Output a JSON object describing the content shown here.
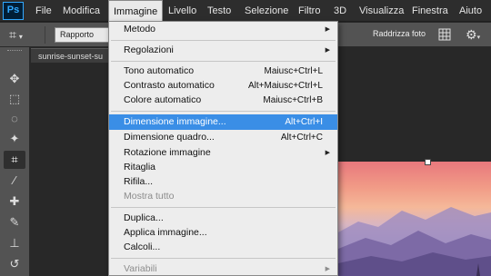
{
  "app": {
    "logo": "Ps"
  },
  "menubar": {
    "items": [
      {
        "label": "File"
      },
      {
        "label": "Modifica"
      },
      {
        "label": "Immagine"
      },
      {
        "label": "Livello"
      },
      {
        "label": "Testo"
      },
      {
        "label": "Selezione"
      },
      {
        "label": "Filtro"
      },
      {
        "label": "3D"
      },
      {
        "label": "Visualizza"
      },
      {
        "label": "Finestra"
      },
      {
        "label": "Aiuto"
      }
    ],
    "active": "Immagine"
  },
  "options": {
    "tool_icon": "crop-icon",
    "ratio_value": "Rapporto",
    "straighten_label": "Raddrizza foto",
    "grid_icon": "grid-overlay-icon",
    "settings_icon": "gear-icon"
  },
  "toolbar": {
    "tools": [
      {
        "name": "move-tool-icon",
        "glyph": "✥"
      },
      {
        "name": "marquee-tool-icon",
        "glyph": "⬚"
      },
      {
        "name": "lasso-tool-icon",
        "glyph": "◌"
      },
      {
        "name": "magic-wand-tool-icon",
        "glyph": "✦"
      },
      {
        "name": "crop-tool-icon",
        "glyph": "⌗"
      },
      {
        "name": "eyedropper-tool-icon",
        "glyph": "⁄"
      },
      {
        "name": "healing-brush-tool-icon",
        "glyph": "✚"
      },
      {
        "name": "brush-tool-icon",
        "glyph": "✎"
      },
      {
        "name": "stamp-tool-icon",
        "glyph": "⊥"
      },
      {
        "name": "history-brush-tool-icon",
        "glyph": "↺"
      }
    ],
    "selected": "crop-tool-icon"
  },
  "document": {
    "tab_title": "sunrise-sunset-su"
  },
  "menu": {
    "items": [
      {
        "label": "Metodo",
        "submenu": true
      },
      {
        "separator": true
      },
      {
        "label": "Regolazioni",
        "submenu": true
      },
      {
        "separator": true
      },
      {
        "label": "Tono automatico",
        "shortcut": "Maiusc+Ctrl+L"
      },
      {
        "label": "Contrasto automatico",
        "shortcut": "Alt+Maiusc+Ctrl+L"
      },
      {
        "label": "Colore automatico",
        "shortcut": "Maiusc+Ctrl+B"
      },
      {
        "separator": true
      },
      {
        "label": "Dimensione immagine...",
        "shortcut": "Alt+Ctrl+I",
        "highlighted": true
      },
      {
        "label": "Dimensione quadro...",
        "shortcut": "Alt+Ctrl+C"
      },
      {
        "label": "Rotazione immagine",
        "submenu": true
      },
      {
        "label": "Ritaglia"
      },
      {
        "label": "Rifila..."
      },
      {
        "label": "Mostra tutto",
        "disabled": true
      },
      {
        "separator": true
      },
      {
        "label": "Duplica..."
      },
      {
        "label": "Applica immagine..."
      },
      {
        "label": "Calcoli..."
      },
      {
        "separator": true
      },
      {
        "label": "Variabili",
        "submenu": true,
        "disabled": true
      }
    ]
  },
  "colors": {
    "highlight": "#3a8ee6",
    "ps_blue": "#31a8ff"
  }
}
